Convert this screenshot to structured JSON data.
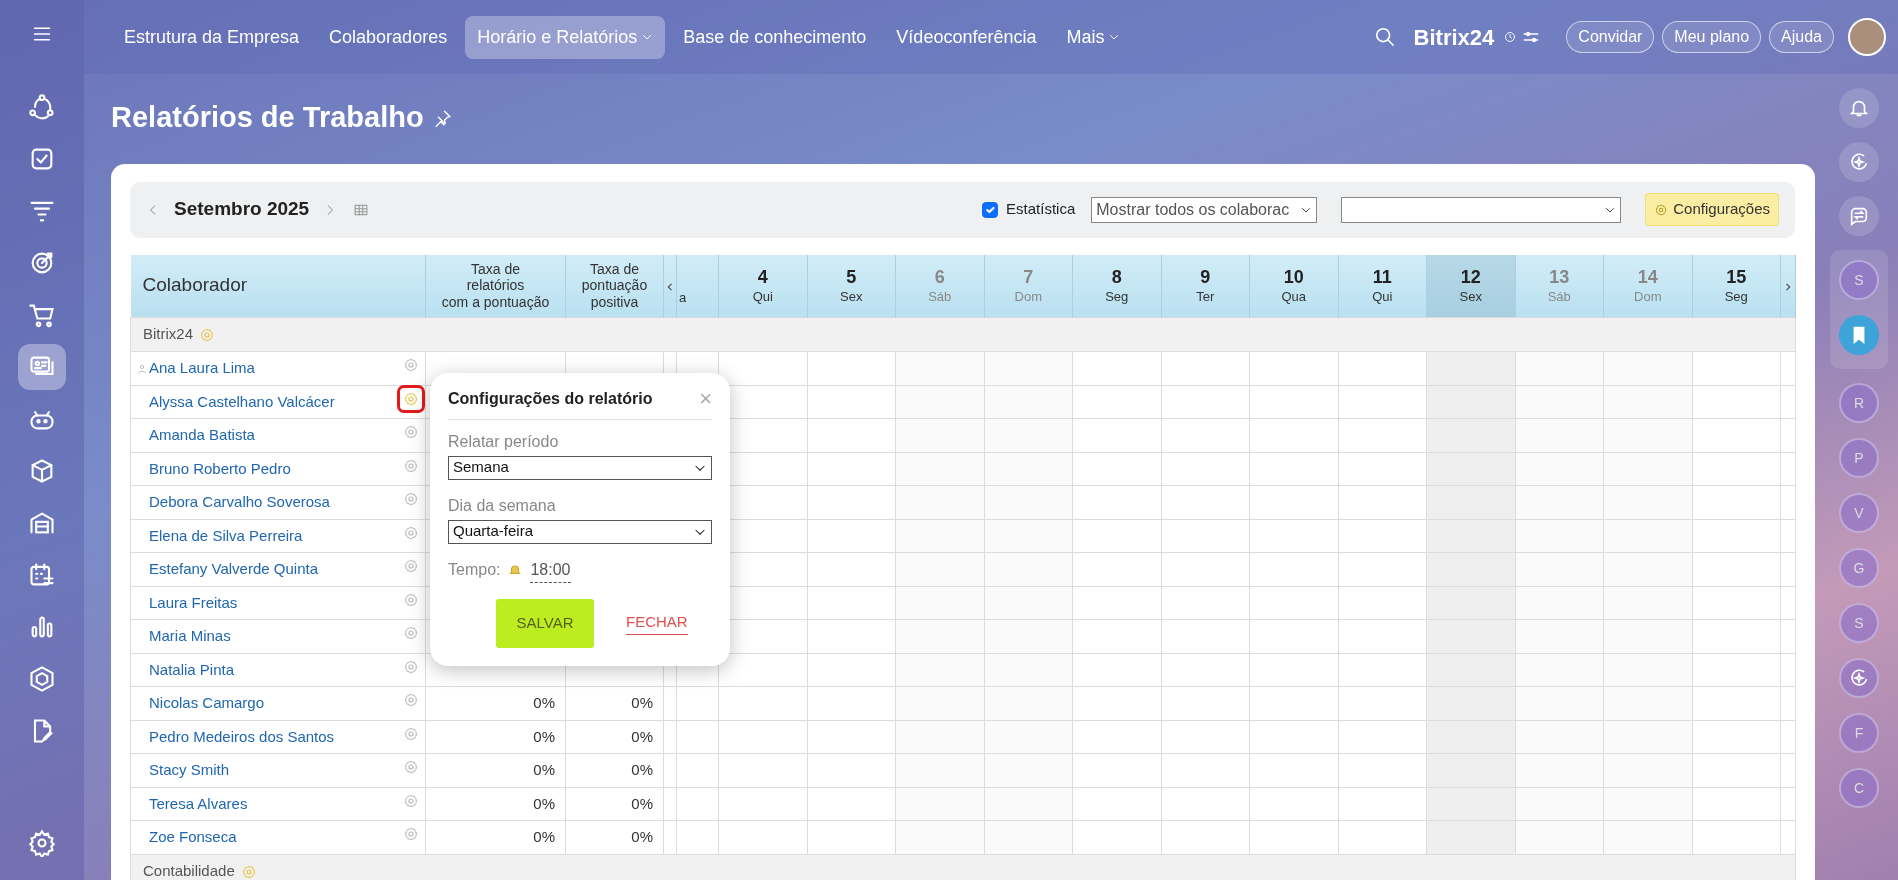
{
  "top_nav": {
    "items": [
      {
        "label": "Estrutura da Empresa",
        "selected": false,
        "dropdown": false
      },
      {
        "label": "Colaboradores",
        "selected": false,
        "dropdown": false
      },
      {
        "label": "Horário e Relatórios",
        "selected": true,
        "dropdown": true
      },
      {
        "label": "Base de conhecimento",
        "selected": false,
        "dropdown": false
      },
      {
        "label": "Vídeoconferência",
        "selected": false,
        "dropdown": false
      },
      {
        "label": "Mais",
        "selected": false,
        "dropdown": true
      }
    ],
    "logo": "Bitrix",
    "logo_number": "24",
    "buttons": [
      "Convidar",
      "Meu plano",
      "Ajuda"
    ]
  },
  "left_sidebar": {
    "items": [
      {
        "kind": "crm",
        "selected": false
      },
      {
        "kind": "tasks",
        "selected": false
      },
      {
        "kind": "funnel",
        "selected": false
      },
      {
        "kind": "target",
        "selected": false
      },
      {
        "kind": "cart",
        "selected": false
      },
      {
        "kind": "cards",
        "selected": true
      },
      {
        "kind": "robot",
        "selected": false
      },
      {
        "kind": "box",
        "selected": false
      },
      {
        "kind": "store",
        "selected": false
      },
      {
        "kind": "calendar",
        "selected": false
      },
      {
        "kind": "chart",
        "selected": false
      },
      {
        "kind": "hexagon",
        "selected": false
      },
      {
        "kind": "document",
        "selected": false
      },
      {
        "kind": "settings",
        "selected": false
      }
    ]
  },
  "right_sidebar": {
    "items": [
      {
        "kind": "bell"
      },
      {
        "kind": "sparkle"
      },
      {
        "kind": "chat"
      },
      {
        "kind": "letter",
        "letter": "S",
        "pinned": true
      },
      {
        "kind": "bookmark",
        "pinned": true
      },
      {
        "kind": "letter",
        "letter": "R",
        "pinned": false
      },
      {
        "kind": "letter",
        "letter": "P",
        "pinned": false
      },
      {
        "kind": "letter",
        "letter": "V",
        "pinned": false
      },
      {
        "kind": "letter",
        "letter": "G",
        "pinned": false
      },
      {
        "kind": "letter",
        "letter": "S",
        "pinned": false
      },
      {
        "kind": "sparkle-avatar",
        "pinned": false
      },
      {
        "kind": "letter",
        "letter": "F",
        "pinned": false
      },
      {
        "kind": "letter",
        "letter": "C",
        "pinned": false
      }
    ]
  },
  "page_title": "Relatórios de Trabalho",
  "toolbar": {
    "month": "Setembro 2025",
    "statistics": {
      "label": "Estatística",
      "checked": true
    },
    "employee_filter": "Mostrar todos os colaborac",
    "settings_button": "Configurações"
  },
  "table": {
    "columns": [
      "Colaborador",
      "Taxa de\nrelatórios\ncom a pontuação",
      "Taxa de\npontuação\npositiva"
    ],
    "days": [
      {
        "kind": "partial",
        "weekday": "a",
        "weekend": false,
        "today": false
      },
      {
        "kind": "full",
        "day": "4",
        "weekday": "Qui",
        "weekend": false,
        "today": false
      },
      {
        "kind": "full",
        "day": "5",
        "weekday": "Sex",
        "weekend": false,
        "today": false
      },
      {
        "kind": "full",
        "day": "6",
        "weekday": "Sáb",
        "weekend": true,
        "today": false
      },
      {
        "kind": "full",
        "day": "7",
        "weekday": "Dom",
        "weekend": true,
        "today": false
      },
      {
        "kind": "full",
        "day": "8",
        "weekday": "Seg",
        "weekend": false,
        "today": false
      },
      {
        "kind": "full",
        "day": "9",
        "weekday": "Ter",
        "weekend": false,
        "today": false
      },
      {
        "kind": "full",
        "day": "10",
        "weekday": "Qua",
        "weekend": false,
        "today": false
      },
      {
        "kind": "full",
        "day": "11",
        "weekday": "Qui",
        "weekend": false,
        "today": false
      },
      {
        "kind": "full",
        "day": "12",
        "weekday": "Sex",
        "weekend": false,
        "today": true
      },
      {
        "kind": "full",
        "day": "13",
        "weekday": "Sáb",
        "weekend": true,
        "today": false
      },
      {
        "kind": "full",
        "day": "14",
        "weekday": "Dom",
        "weekend": true,
        "today": false
      },
      {
        "kind": "full",
        "day": "15",
        "weekday": "Seg",
        "weekend": false,
        "today": false
      }
    ],
    "groups": [
      {
        "name": "Bitrix24",
        "rows": [
          {
            "name": "Ana Laura Lima",
            "head": true,
            "highlighted": false
          },
          {
            "name": "Alyssa Castelhano Valcácer",
            "head": false,
            "highlighted": true
          },
          {
            "name": "Amanda Batista",
            "head": false,
            "highlighted": false
          },
          {
            "name": "Bruno Roberto Pedro",
            "head": false,
            "highlighted": false
          },
          {
            "name": "Debora Carvalho Soverosa",
            "head": false,
            "highlighted": false
          },
          {
            "name": "Elena de Silva Perreira",
            "head": false,
            "highlighted": false
          },
          {
            "name": "Estefany Valverde Quinta",
            "head": false,
            "highlighted": false
          },
          {
            "name": "Laura Freitas",
            "head": false,
            "highlighted": false
          },
          {
            "name": "Maria Minas",
            "head": false,
            "highlighted": false
          },
          {
            "name": "Natalia Pinta",
            "head": false,
            "highlighted": false
          },
          {
            "name": "Nicolas Camargo",
            "head": false,
            "highlighted": false,
            "rate_reports": "0%",
            "rate_positive": "0%"
          },
          {
            "name": "Pedro Medeiros dos Santos",
            "head": false,
            "highlighted": false,
            "rate_reports": "0%",
            "rate_positive": "0%"
          },
          {
            "name": "Stacy Smith",
            "head": false,
            "highlighted": false,
            "rate_reports": "0%",
            "rate_positive": "0%"
          },
          {
            "name": "Teresa Alvares",
            "head": false,
            "highlighted": false,
            "rate_reports": "0%",
            "rate_positive": "0%"
          },
          {
            "name": "Zoe Fonseca",
            "head": false,
            "highlighted": false,
            "rate_reports": "0%",
            "rate_positive": "0%"
          }
        ]
      },
      {
        "name": "Contabilidade"
      }
    ]
  },
  "popup": {
    "title": "Configurações do relatório",
    "close_icon": "×",
    "fields": [
      {
        "label": "Relatar período",
        "value": "Semana"
      },
      {
        "label": "Dia da semana",
        "value": "Quarta-feira"
      }
    ],
    "time_label": "Tempo:",
    "time_value": "18:00",
    "save": "SALVAR",
    "cancel": "FECHAR"
  }
}
